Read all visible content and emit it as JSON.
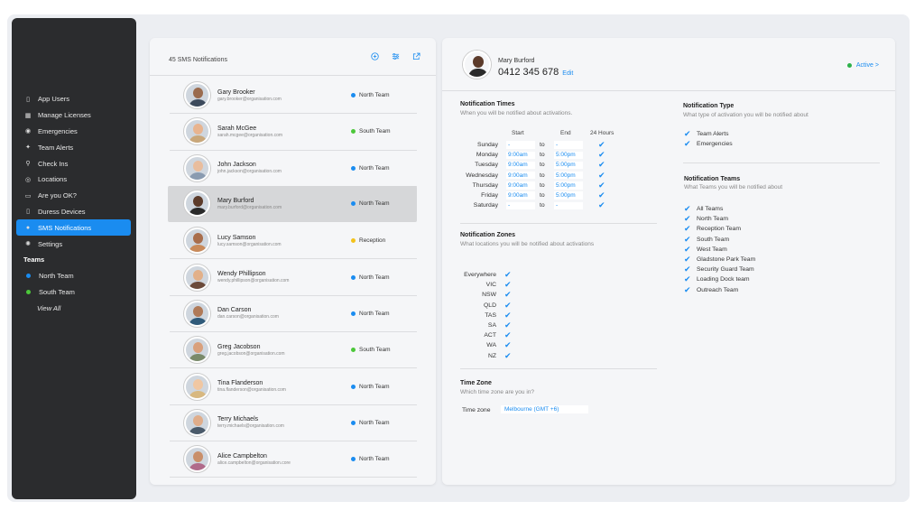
{
  "sidebar": {
    "items": [
      {
        "label": "App Users",
        "icon": "phone-icon"
      },
      {
        "label": "Manage Licenses",
        "icon": "license-icon"
      },
      {
        "label": "Emergencies",
        "icon": "emergency-icon"
      },
      {
        "label": "Team Alerts",
        "icon": "team-alert-icon"
      },
      {
        "label": "Check Ins",
        "icon": "location-pin-icon"
      },
      {
        "label": "Locations",
        "icon": "locations-icon"
      },
      {
        "label": "Are you OK?",
        "icon": "chat-icon"
      },
      {
        "label": "Duress Devices",
        "icon": "device-icon"
      },
      {
        "label": "SMS Notifications",
        "icon": "bell-icon"
      },
      {
        "label": "Settings",
        "icon": "gear-icon"
      }
    ],
    "teams_heading": "Teams",
    "teams": [
      {
        "label": "North Team",
        "color": "#1a8cf0"
      },
      {
        "label": "South Team",
        "color": "#4cc73a"
      }
    ],
    "view_all": "View All"
  },
  "contacts_panel": {
    "title": "45 SMS Notifications",
    "contacts": [
      {
        "name": "Gary Brooker",
        "email": "gary.brooker@organisation.com",
        "team": "North Team",
        "team_color": "#1a8cf0",
        "skin": "#9a6b4e",
        "shirt": "#3d4a5c"
      },
      {
        "name": "Sarah McGee",
        "email": "sarah.mcgee@organisation.com",
        "team": "South Team",
        "team_color": "#4cc73a",
        "skin": "#e8b48f",
        "shirt": "#c9a77a"
      },
      {
        "name": "John Jackson",
        "email": "john.jackson@organisation.com",
        "team": "North Team",
        "team_color": "#1a8cf0",
        "skin": "#e9bd9d",
        "shirt": "#8a9bb0"
      },
      {
        "name": "Mary Burford",
        "email": "mary.burford@organisation.com",
        "team": "North Team",
        "team_color": "#1a8cf0",
        "skin": "#5c3b2a",
        "shirt": "#2a2a2a"
      },
      {
        "name": "Lucy Samson",
        "email": "lucy.samson@organisation.com",
        "team": "Reception",
        "team_color": "#f3c21b",
        "skin": "#a86d4b",
        "shirt": "#c98a5a"
      },
      {
        "name": "Wendy Phillipson",
        "email": "wendy.phillipson@organisation.com",
        "team": "North Team",
        "team_color": "#1a8cf0",
        "skin": "#e2b089",
        "shirt": "#6b4a3a"
      },
      {
        "name": "Dan Carson",
        "email": "dan.carson@organisation.com",
        "team": "North Team",
        "team_color": "#1a8cf0",
        "skin": "#b07a58",
        "shirt": "#2f5a7a"
      },
      {
        "name": "Greg Jacobson",
        "email": "greg.jacobson@organisation.com",
        "team": "South Team",
        "team_color": "#4cc73a",
        "skin": "#d9a07c",
        "shirt": "#7a8a6a"
      },
      {
        "name": "Tina Flanderson",
        "email": "tina.flanderson@organisation.com",
        "team": "North Team",
        "team_color": "#1a8cf0",
        "skin": "#f0c7a2",
        "shirt": "#d8b880"
      },
      {
        "name": "Terry Michaels",
        "email": "terry.michaels@organisation.com",
        "team": "North Team",
        "team_color": "#1a8cf0",
        "skin": "#e0ad8a",
        "shirt": "#4a5a6a"
      },
      {
        "name": "Alice Campbelton",
        "email": "alice.campbelton@organisation.core",
        "team": "North Team",
        "team_color": "#1a8cf0",
        "skin": "#c98f6a",
        "shirt": "#b06a8a"
      }
    ]
  },
  "detail": {
    "name": "Mary Burford",
    "phone": "0412 345 678",
    "edit_label": "Edit",
    "status": "Active >",
    "status_color": "#2db14a",
    "notification_times": {
      "title": "Notification Times",
      "subtitle": "When you will be notified about activations.",
      "col_start": "Start",
      "col_end": "End",
      "col_24h": "24 Hours",
      "to_label": "to",
      "rows": [
        {
          "day": "Sunday",
          "start": "-",
          "end": "-"
        },
        {
          "day": "Monday",
          "start": "9:00am",
          "end": "5:00pm"
        },
        {
          "day": "Tuesday",
          "start": "9:00am",
          "end": "5:00pm"
        },
        {
          "day": "Wednesday",
          "start": "9:00am",
          "end": "5:00pm"
        },
        {
          "day": "Thursday",
          "start": "9:00am",
          "end": "5:00pm"
        },
        {
          "day": "Friday",
          "start": "9:00am",
          "end": "5:00pm"
        },
        {
          "day": "Saturday",
          "start": "-",
          "end": "-"
        }
      ]
    },
    "notification_zones": {
      "title": "Notification Zones",
      "subtitle": "What locations you will be notified about activations",
      "zones": [
        "Everywhere",
        "VIC",
        "NSW",
        "QLD",
        "TAS",
        "SA",
        "ACT",
        "WA",
        "NZ"
      ]
    },
    "time_zone": {
      "title": "Time Zone",
      "subtitle": "Which time zone are you in?",
      "label": "Time zone",
      "value": "Melbourne (GMT +6)"
    },
    "notification_type": {
      "title": "Notification Type",
      "subtitle": "What type of activation you will be notified about",
      "items": [
        "Team Alerts",
        "Emergencies"
      ]
    },
    "notification_teams": {
      "title": "Notification Teams",
      "subtitle": "What Teams you will be notified about",
      "items": [
        "All Teams",
        "North Team",
        "Reception Team",
        "South Team",
        "West Team",
        "Gladstone Park Team",
        "Security Guard Team",
        "Loading Dock team",
        "Outreach Team"
      ]
    }
  }
}
